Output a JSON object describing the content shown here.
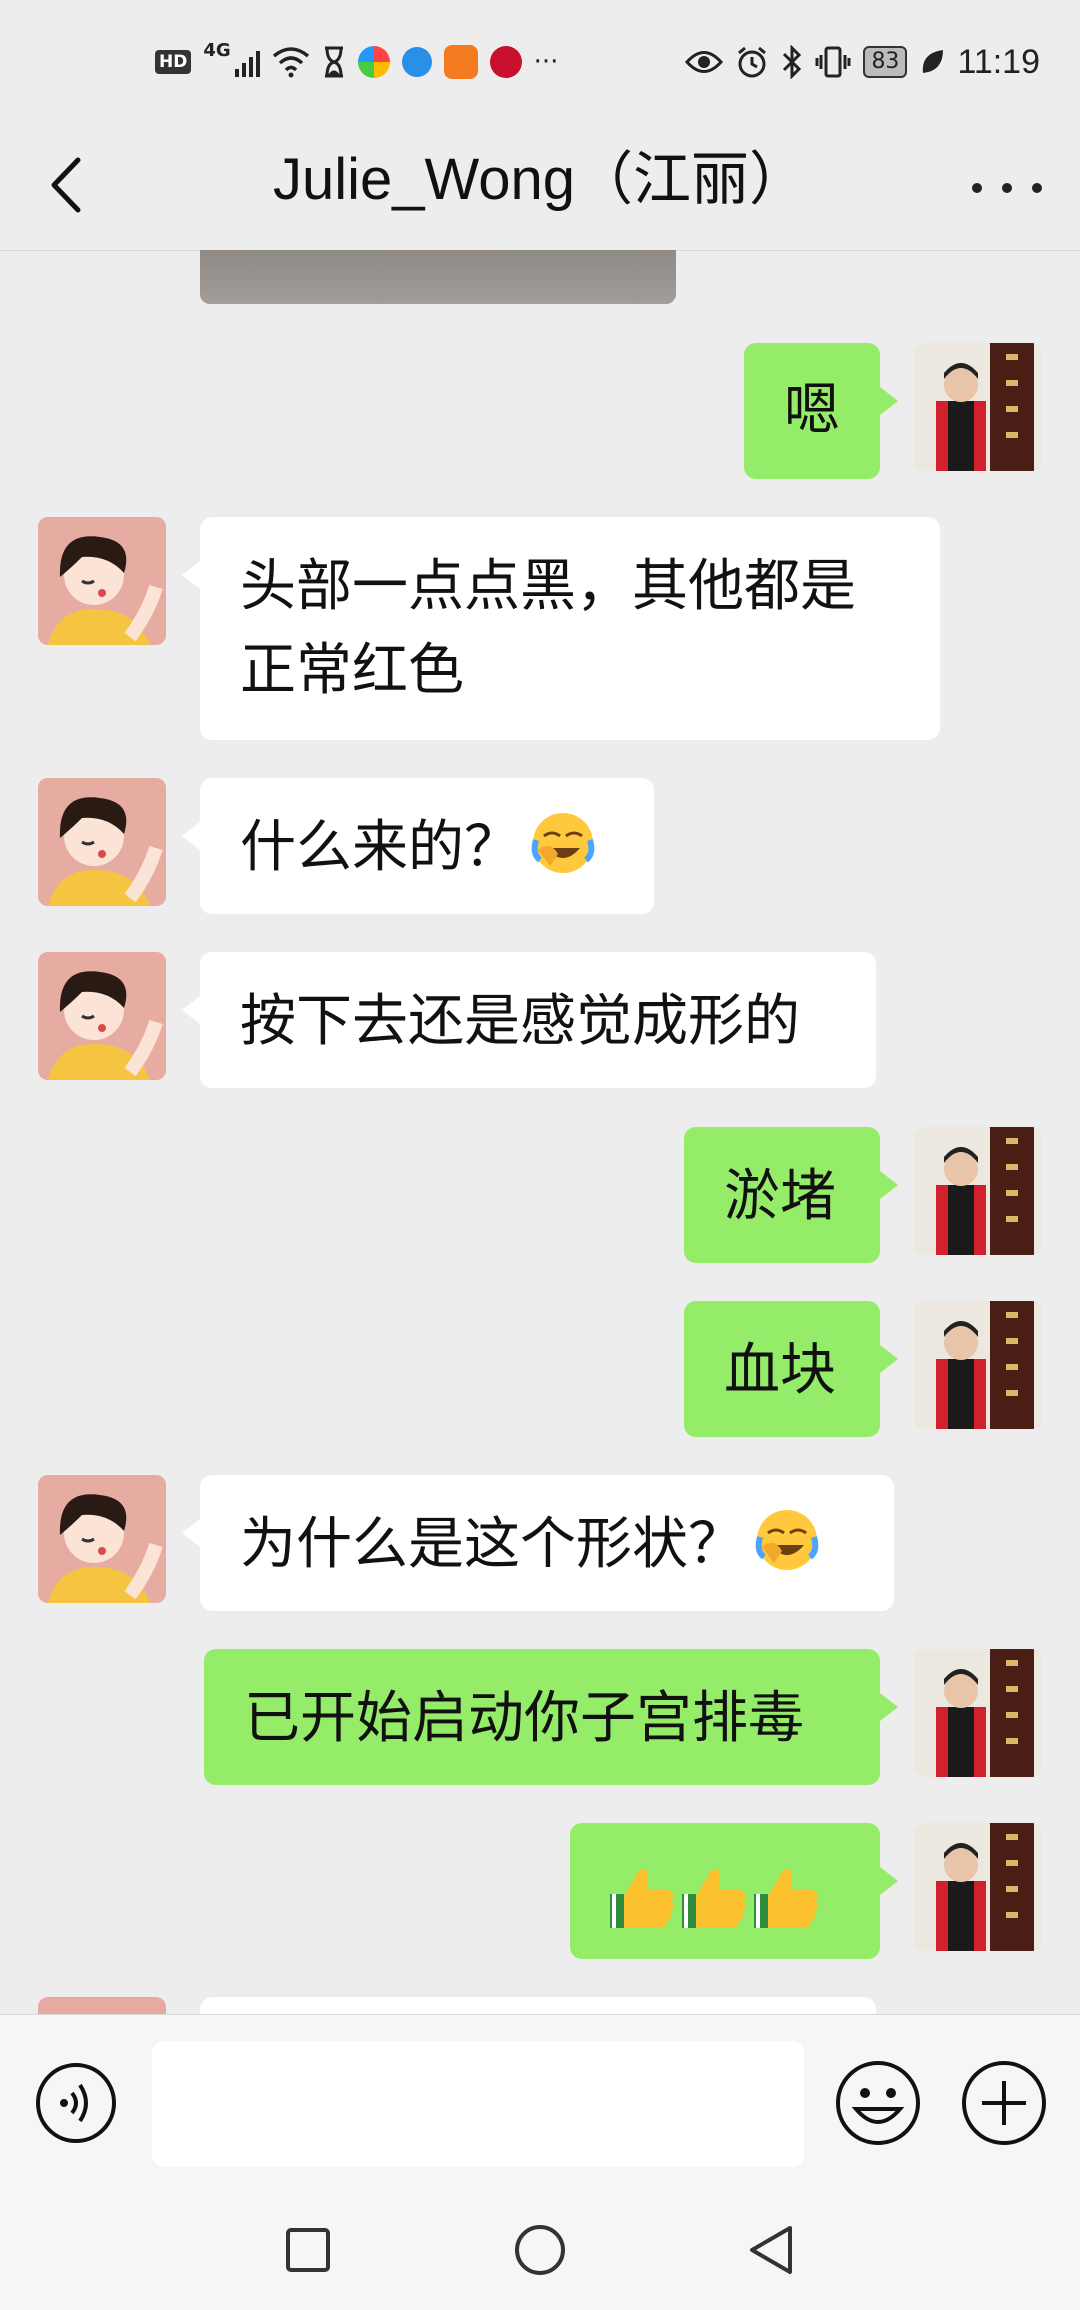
{
  "status_bar": {
    "hd": "HD",
    "network": "4G",
    "more": "···",
    "battery": "83",
    "time": "11:19"
  },
  "header": {
    "title": "Julie_Wong（江丽）"
  },
  "messages": [
    {
      "side": "out",
      "text": "嗯"
    },
    {
      "side": "in",
      "lines": [
        "头部一点点黑，其他都是",
        "正常红色"
      ]
    },
    {
      "side": "in",
      "text": "什么来的？",
      "emoji": "face-with-tears-of-joy"
    },
    {
      "side": "in",
      "text": "按下去还是感觉成形的"
    },
    {
      "side": "out",
      "text": "淤堵"
    },
    {
      "side": "out",
      "text": "血块"
    },
    {
      "side": "in",
      "text": "为什么是这个形状？",
      "emoji": "face-with-tears-of-joy"
    },
    {
      "side": "out",
      "text": "已开始启动你子宫排毒"
    },
    {
      "side": "out",
      "text": "",
      "emoji": "thumbs-up x3"
    }
  ],
  "colors": {
    "background": "#ededed",
    "outgoing_bubble": "#95ec69",
    "incoming_bubble": "#ffffff"
  },
  "input_bar": {
    "icons": [
      "voice-icon",
      "emoji-icon",
      "plus-icon"
    ]
  },
  "nav_bar": {
    "icons": [
      "recent-apps-icon",
      "home-icon",
      "back-icon"
    ]
  }
}
